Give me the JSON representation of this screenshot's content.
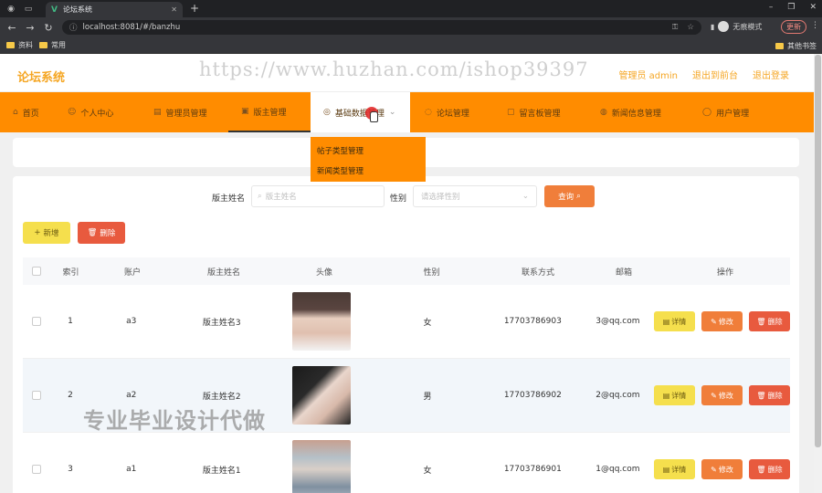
{
  "browser": {
    "tab_title": "论坛系统",
    "url": "localhost:8081/#/banzhu",
    "profile_name": "无痕模式",
    "update_label": "更新",
    "bookmarks": [
      "资料",
      "常用"
    ],
    "other_bookmarks": "其他书签"
  },
  "header": {
    "site_title": "论坛系统",
    "admin_label": "管理员 admin",
    "back_link": "退出到前台",
    "logout_link": "退出登录"
  },
  "watermark_url": "https://www.huzhan.com/ishop39397",
  "watermark_cn": "专业毕业设计代做",
  "nav": [
    {
      "label": "首页",
      "icon": "home-icon"
    },
    {
      "label": "个人中心",
      "icon": "user-icon"
    },
    {
      "label": "管理员管理",
      "icon": "admin-icon"
    },
    {
      "label": "版主管理",
      "icon": "moderator-icon"
    },
    {
      "label": "基础数据管理",
      "icon": "settings-icon"
    },
    {
      "label": "论坛管理",
      "icon": "forum-icon"
    },
    {
      "label": "留言板管理",
      "icon": "message-icon"
    },
    {
      "label": "新闻信息管理",
      "icon": "news-icon"
    },
    {
      "label": "用户管理",
      "icon": "users-icon"
    }
  ],
  "dropdown": [
    "帖子类型管理",
    "新闻类型管理"
  ],
  "search": {
    "name_label": "版主姓名",
    "name_placeholder": "版主姓名",
    "gender_label": "性别",
    "gender_placeholder": "请选择性别",
    "button": "查询"
  },
  "actions": {
    "add": "新增",
    "delete": "删除"
  },
  "table": {
    "headers": [
      "索引",
      "账户",
      "版主姓名",
      "头像",
      "性别",
      "联系方式",
      "邮箱",
      "操作"
    ],
    "rows": [
      {
        "index": "1",
        "account": "a3",
        "name": "版主姓名3",
        "gender": "女",
        "phone": "17703786903",
        "email": "3@qq.com"
      },
      {
        "index": "2",
        "account": "a2",
        "name": "版主姓名2",
        "gender": "男",
        "phone": "17703786902",
        "email": "2@qq.com"
      },
      {
        "index": "3",
        "account": "a1",
        "name": "版主姓名1",
        "gender": "女",
        "phone": "17703786901",
        "email": "1@qq.com"
      }
    ],
    "ops": {
      "detail": "详情",
      "edit": "修改",
      "remove": "删除"
    }
  }
}
